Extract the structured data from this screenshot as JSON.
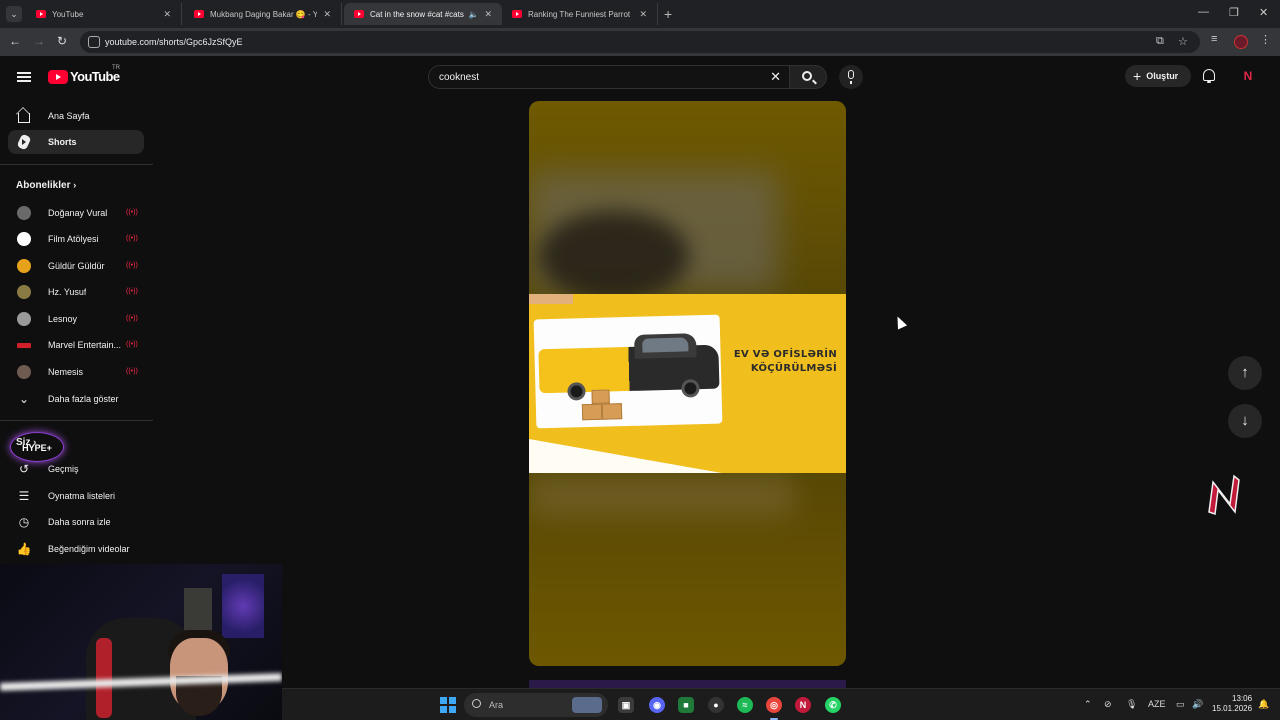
{
  "browser": {
    "tabs": [
      {
        "title": "YouTube",
        "active": false
      },
      {
        "title": "Mukbang Daging Bakar 😋 - Yo",
        "active": false
      },
      {
        "title": "Cat in the snow #cat #cats",
        "active": true
      },
      {
        "title": "Ranking The Funniest Parrot Mo",
        "active": false
      }
    ],
    "url": "youtube.com/shorts/Gpc6JzSfQyE"
  },
  "header": {
    "logo_text": "YouTube",
    "country": "TR",
    "search_value": "cooknest",
    "create_label": "Oluştur"
  },
  "sidebar": {
    "main": [
      {
        "label": "Ana Sayfa",
        "icon": "home-icon"
      },
      {
        "label": "Shorts",
        "icon": "shorts-icon",
        "active": true
      }
    ],
    "subs_heading": "Abonelikler",
    "subscriptions": [
      {
        "label": "Doğanay Vural",
        "color": "#6a6a6a"
      },
      {
        "label": "Film Atölyesi",
        "color": "#ffffff"
      },
      {
        "label": "Güldür Güldür",
        "color": "#e6a21a"
      },
      {
        "label": "Hz. Yusuf",
        "color": "#8a7a44"
      },
      {
        "label": "Lesnoy",
        "color": "#9a9a9a"
      },
      {
        "label": "Marvel Entertain...",
        "color": "#d0202a"
      },
      {
        "label": "Nemesis",
        "color": "#6e5a50"
      }
    ],
    "show_more": "Daha fazla göster",
    "you_heading": "Siz",
    "you_items": [
      {
        "label": "Geçmiş",
        "icon": "history-icon"
      },
      {
        "label": "Oynatma listeleri",
        "icon": "playlist-icon"
      },
      {
        "label": "Daha sonra izle",
        "icon": "clock-icon"
      },
      {
        "label": "Beğendiğim videolar",
        "icon": "thumbs-up-icon"
      }
    ]
  },
  "video": {
    "banner_text_line1": "EV VƏ OFİSLƏRİN",
    "banner_text_line2": "KÖÇÜRÜLMƏSİ",
    "accent": "#f1bf1d"
  },
  "overlay": {
    "hype_text": "HYPE+"
  },
  "taskbar": {
    "search_placeholder": "Ara",
    "language": "AZE",
    "time": "13:06",
    "date": "15.01.2026"
  }
}
